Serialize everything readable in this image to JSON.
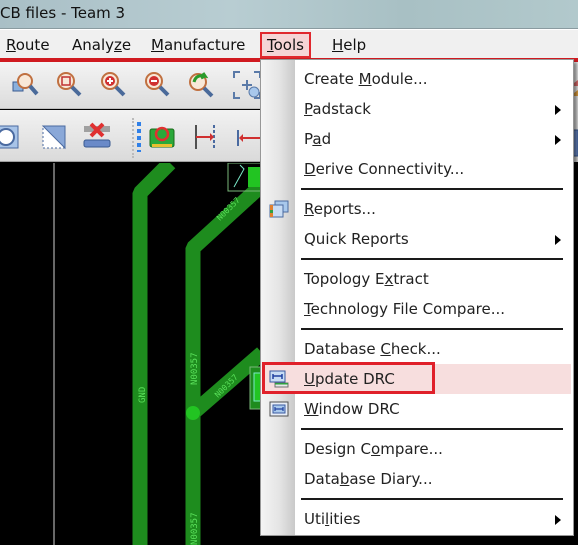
{
  "window": {
    "title": "CB files - Team 3"
  },
  "menubar": {
    "items": [
      {
        "label": "Route",
        "mnemonic_index": 0
      },
      {
        "label": "Analyze",
        "mnemonic_index": 5
      },
      {
        "label": "Manufacture",
        "mnemonic_index": 0
      },
      {
        "label": "Tools",
        "mnemonic_index": 0,
        "active": true
      },
      {
        "label": "Help",
        "mnemonic_index": 0
      }
    ]
  },
  "toolbar1": {
    "icons": [
      "zoom-area-icon",
      "zoom-box-icon",
      "zoom-in-icon",
      "zoom-out-icon",
      "zoom-previous-icon",
      "zoom-fit-icon"
    ]
  },
  "toolbar2": {
    "icons": [
      "circle-shape-icon",
      "shape-select-icon",
      "delete-icon",
      "component-icon",
      "dimension-right-icon",
      "dimension-left-icon"
    ]
  },
  "canvas": {
    "trace_color": "#1e8c1e",
    "bright_color": "#22c422",
    "net_labels": [
      "GND",
      "N00357",
      "N00357",
      "N00357",
      "N00357"
    ]
  },
  "tools_menu": {
    "items": [
      {
        "label": "Create Module...",
        "mnemonic": "M",
        "submenu": false
      },
      {
        "label": "Padstack",
        "mnemonic": "P",
        "submenu": true
      },
      {
        "label": "Pad",
        "mnemonic": "a",
        "submenu": true
      },
      {
        "label": "Derive Connectivity...",
        "mnemonic": "D",
        "submenu": false,
        "separator_after": true
      },
      {
        "label": "Reports...",
        "mnemonic": "R",
        "submenu": false,
        "icon": "reports-icon"
      },
      {
        "label": "Quick Reports",
        "mnemonic": "",
        "submenu": true,
        "separator_after": true
      },
      {
        "label": "Topology Extract",
        "mnemonic": "x",
        "submenu": false
      },
      {
        "label": "Technology File Compare...",
        "mnemonic": "T",
        "submenu": false,
        "separator_after": true
      },
      {
        "label": "Database Check...",
        "mnemonic": "C",
        "submenu": false
      },
      {
        "label": "Update DRC",
        "mnemonic": "U",
        "submenu": false,
        "icon": "update-drc-icon",
        "highlighted": true
      },
      {
        "label": "Window DRC",
        "mnemonic": "W",
        "submenu": false,
        "icon": "window-drc-icon",
        "separator_after": true
      },
      {
        "label": "Design Compare...",
        "mnemonic": "o",
        "submenu": false
      },
      {
        "label": "Database Diary...",
        "mnemonic": "b",
        "submenu": false,
        "separator_after": true
      },
      {
        "label": "Utilities",
        "mnemonic": "l",
        "submenu": true
      }
    ]
  },
  "colors": {
    "annotation_red": "#e0202a",
    "highlight_bg": "#f7dede"
  }
}
